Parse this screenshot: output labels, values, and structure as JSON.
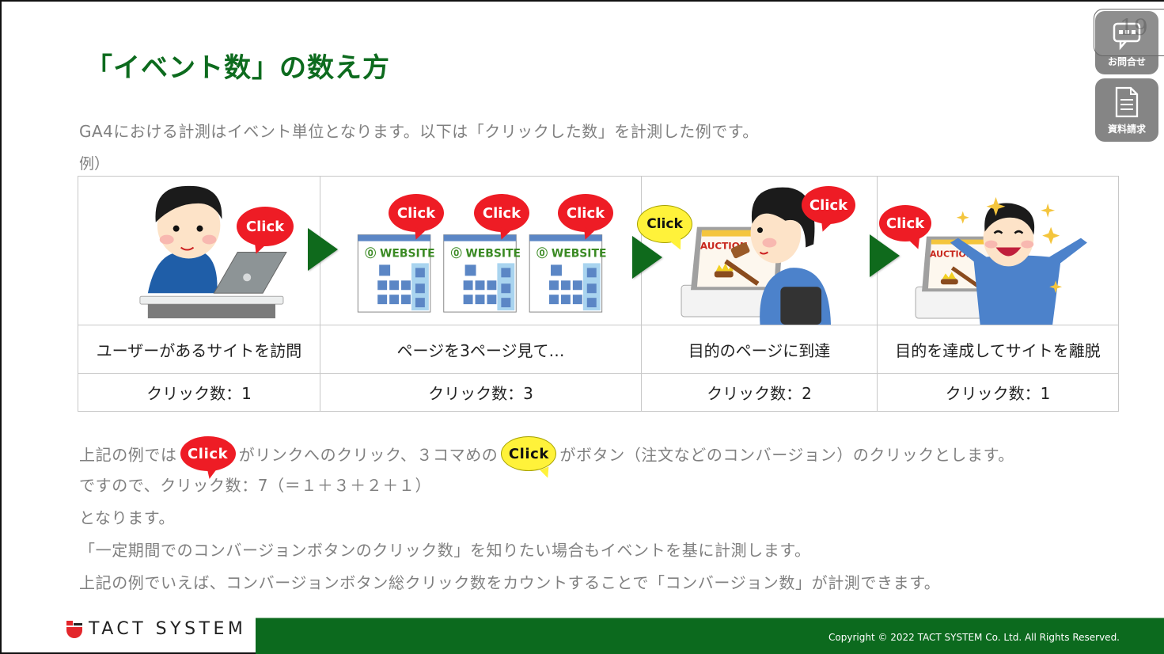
{
  "page": {
    "title": "「イベント数」の数え方",
    "intro": "GA4における計測はイベント単位となります。以下は「クリックした数」を計測した例です。",
    "example_label": "例）"
  },
  "side_buttons": {
    "page_number": "19",
    "contact": {
      "label": "お問合せ",
      "icon": "chat-bubble-icon"
    },
    "documents": {
      "label": "資料請求",
      "icon": "document-icon"
    }
  },
  "flow": {
    "bubble_label": "Click",
    "steps": [
      {
        "illustration": "man-at-laptop",
        "bubbles": [
          "red"
        ],
        "description": "ユーザーがあるサイトを訪問",
        "count": "クリック数：1"
      },
      {
        "illustration": "three-website-pages",
        "bubbles": [
          "red",
          "red",
          "red"
        ],
        "description": "ページを3ページ見て…",
        "count": "クリック数：3",
        "website_label": "WEBSITE"
      },
      {
        "illustration": "man-on-auction-site",
        "bubbles": [
          "yellow",
          "red"
        ],
        "description": "目的のページに到達",
        "count": "クリック数：2",
        "auction_label": "AUCTION"
      },
      {
        "illustration": "happy-man-leaving-site",
        "bubbles": [
          "red"
        ],
        "description": "目的を達成してサイトを離脱",
        "count": "クリック数：1",
        "auction_label": "AUCTION"
      }
    ],
    "arrow_color": "#0f6a1c"
  },
  "explanation": {
    "line1_a": "上記の例では",
    "line1_b": "がリンクへのクリック、３コマめの",
    "line1_c": "がボタン（注文などのコンバージョン）のクリックとします。",
    "line2": "ですので、クリック数：7（＝１＋３＋２＋１）",
    "line3": "となります。",
    "line4": "「一定期間でのコンバージョンボタンのクリック数」を知りたい場合もイベントを基に計測します。",
    "line5": "上記の例でいえば、コンバージョンボタン総クリック数をカウントすることで「コンバージョン数」が計測できます。"
  },
  "footer": {
    "company": "TACT SYSTEM",
    "copyright": "Copyright © 2022 TACT SYSTEM Co. Ltd. All Rights Reserved."
  },
  "colors": {
    "brand_green": "#0c6a1e",
    "title_green": "#0d6b1e",
    "click_red": "#ee1c25",
    "click_yellow": "#fff23a",
    "body_gray": "#808080",
    "logo_red": "#e3262b"
  }
}
